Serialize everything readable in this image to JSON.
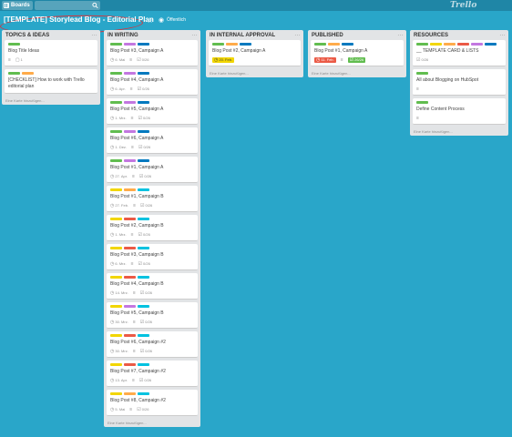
{
  "topbar": {
    "boards_label": "Boards",
    "logo": "Trello"
  },
  "board": {
    "title": "[TEMPLATE] Storylead Blog - Editorial Plan",
    "visibility": "Öffentlich"
  },
  "colors": {
    "green": "#61bd4f",
    "yellow": "#f2d600",
    "orange": "#ffab4a",
    "red": "#eb5a46",
    "purple": "#c377e0",
    "blue": "#0079bf",
    "sky": "#00c2e0",
    "board_bg": "#29a6c9"
  },
  "lists": [
    {
      "name": "TOPICS & IDEAS",
      "add_card": "Eine Karte hinzufügen...",
      "cards": [
        {
          "labels": [
            "green"
          ],
          "title": "Blog Title Ideas",
          "badges": [
            {
              "icon": "description-icon",
              "text": ""
            },
            {
              "icon": "comment-icon",
              "text": "1"
            }
          ]
        },
        {
          "labels": [
            "green",
            "orange"
          ],
          "title": "[CHECKLIST] How to work with Trello editorial plan",
          "badges": []
        }
      ]
    },
    {
      "name": "IN WRITING",
      "add_card": "Eine Karte hinzufügen...",
      "cards": [
        {
          "labels": [
            "green",
            "purple",
            "blue"
          ],
          "title": "Blog Post #3, Campaign A",
          "badges": [
            {
              "icon": "clock-icon",
              "text": "6. Mai"
            },
            {
              "icon": "description-icon",
              "text": ""
            },
            {
              "icon": "checklist-icon",
              "text": "0/26"
            }
          ]
        },
        {
          "labels": [
            "green",
            "purple",
            "blue"
          ],
          "title": "Blog Post #4, Campaign A",
          "badges": [
            {
              "icon": "clock-icon",
              "text": "6. Apr."
            },
            {
              "icon": "description-icon",
              "text": ""
            },
            {
              "icon": "checklist-icon",
              "text": "0/26"
            }
          ]
        },
        {
          "labels": [
            "green",
            "purple",
            "blue"
          ],
          "title": "Blog Post #5, Campaign A",
          "badges": [
            {
              "icon": "clock-icon",
              "text": "1. Mrz."
            },
            {
              "icon": "description-icon",
              "text": ""
            },
            {
              "icon": "checklist-icon",
              "text": "0/26"
            }
          ]
        },
        {
          "labels": [
            "green",
            "purple",
            "blue"
          ],
          "title": "Blog Post #6, Campaign A",
          "badges": [
            {
              "icon": "clock-icon",
              "text": "1. Dez."
            },
            {
              "icon": "description-icon",
              "text": ""
            },
            {
              "icon": "checklist-icon",
              "text": "0/26"
            }
          ]
        },
        {
          "labels": [
            "green",
            "purple",
            "blue"
          ],
          "title": "Blog Post #1, Campaign A",
          "badges": [
            {
              "icon": "clock-icon",
              "text": "27. Apr."
            },
            {
              "icon": "description-icon",
              "text": ""
            },
            {
              "icon": "checklist-icon",
              "text": "0/26"
            }
          ]
        },
        {
          "labels": [
            "yellow",
            "orange",
            "sky"
          ],
          "title": "Blog Post #1, Campaign B",
          "badges": [
            {
              "icon": "clock-icon",
              "text": "27. Feb."
            },
            {
              "icon": "description-icon",
              "text": ""
            },
            {
              "icon": "checklist-icon",
              "text": "0/26"
            }
          ]
        },
        {
          "labels": [
            "yellow",
            "red",
            "sky"
          ],
          "title": "Blog Post #2, Campaign B",
          "badges": [
            {
              "icon": "clock-icon",
              "text": "1. Mrz."
            },
            {
              "icon": "description-icon",
              "text": ""
            },
            {
              "icon": "checklist-icon",
              "text": "0/26"
            }
          ]
        },
        {
          "labels": [
            "yellow",
            "red",
            "sky"
          ],
          "title": "Blog Post #3, Campaign B",
          "badges": [
            {
              "icon": "clock-icon",
              "text": "6. Mrz."
            },
            {
              "icon": "description-icon",
              "text": ""
            },
            {
              "icon": "checklist-icon",
              "text": "0/26"
            }
          ]
        },
        {
          "labels": [
            "yellow",
            "red",
            "sky"
          ],
          "title": "Blog Post #4, Campaign B",
          "badges": [
            {
              "icon": "clock-icon",
              "text": "14. Mrz."
            },
            {
              "icon": "description-icon",
              "text": ""
            },
            {
              "icon": "checklist-icon",
              "text": "0/26"
            }
          ]
        },
        {
          "labels": [
            "yellow",
            "purple",
            "sky"
          ],
          "title": "Blog Post #5, Campaign B",
          "badges": [
            {
              "icon": "clock-icon",
              "text": "30. Mrz."
            },
            {
              "icon": "description-icon",
              "text": ""
            },
            {
              "icon": "checklist-icon",
              "text": "0/26"
            }
          ]
        },
        {
          "labels": [
            "yellow",
            "red",
            "sky"
          ],
          "title": "Blog Post #6, Campaign #2",
          "badges": [
            {
              "icon": "clock-icon",
              "text": "30. Mrz."
            },
            {
              "icon": "description-icon",
              "text": ""
            },
            {
              "icon": "checklist-icon",
              "text": "0/26"
            }
          ]
        },
        {
          "labels": [
            "yellow",
            "red",
            "sky"
          ],
          "title": "Blog Post #7, Campaign #2",
          "badges": [
            {
              "icon": "clock-icon",
              "text": "13. Apr."
            },
            {
              "icon": "description-icon",
              "text": ""
            },
            {
              "icon": "checklist-icon",
              "text": "0/26"
            }
          ]
        },
        {
          "labels": [
            "yellow",
            "orange",
            "sky"
          ],
          "title": "Blog Post #8, Campaign #2",
          "badges": [
            {
              "icon": "clock-icon",
              "text": "5. Mai"
            },
            {
              "icon": "description-icon",
              "text": ""
            },
            {
              "icon": "checklist-icon",
              "text": "0/26"
            }
          ]
        }
      ]
    },
    {
      "name": "IN INTERNAL APPROVAL",
      "add_card": "Eine Karte hinzufügen...",
      "cards": [
        {
          "labels": [
            "green",
            "orange",
            "blue"
          ],
          "title": "Blog Post #2, Campaign A",
          "badges": [
            {
              "icon": "clock-icon",
              "text": "20. Feb.",
              "style": "yellow"
            }
          ]
        }
      ]
    },
    {
      "name": "PUBLISHED",
      "add_card": "Eine Karte hinzufügen...",
      "cards": [
        {
          "labels": [
            "green",
            "orange",
            "blue"
          ],
          "title": "Blog Post #1, Campaign A",
          "badges": [
            {
              "icon": "clock-icon",
              "text": "11. Feb.",
              "style": "red"
            },
            {
              "icon": "description-icon",
              "text": ""
            },
            {
              "icon": "checklist-icon",
              "text": "26/26",
              "style": "green"
            }
          ]
        }
      ]
    },
    {
      "name": "RESOURCES",
      "add_card": "Eine Karte hinzufügen...",
      "cards": [
        {
          "labels": [
            "green",
            "yellow",
            "orange",
            "red",
            "purple",
            "blue"
          ],
          "title": "__ TEMPLATE CARD & LISTS",
          "badges": [
            {
              "icon": "checklist-icon",
              "text": "0/26"
            }
          ]
        },
        {
          "labels": [
            "green"
          ],
          "title": "All about Blogging on HubSpot",
          "badges": [
            {
              "icon": "description-icon",
              "text": ""
            }
          ]
        },
        {
          "labels": [
            "green"
          ],
          "title": "Define Content Process",
          "badges": [
            {
              "icon": "description-icon",
              "text": ""
            }
          ]
        }
      ]
    }
  ]
}
